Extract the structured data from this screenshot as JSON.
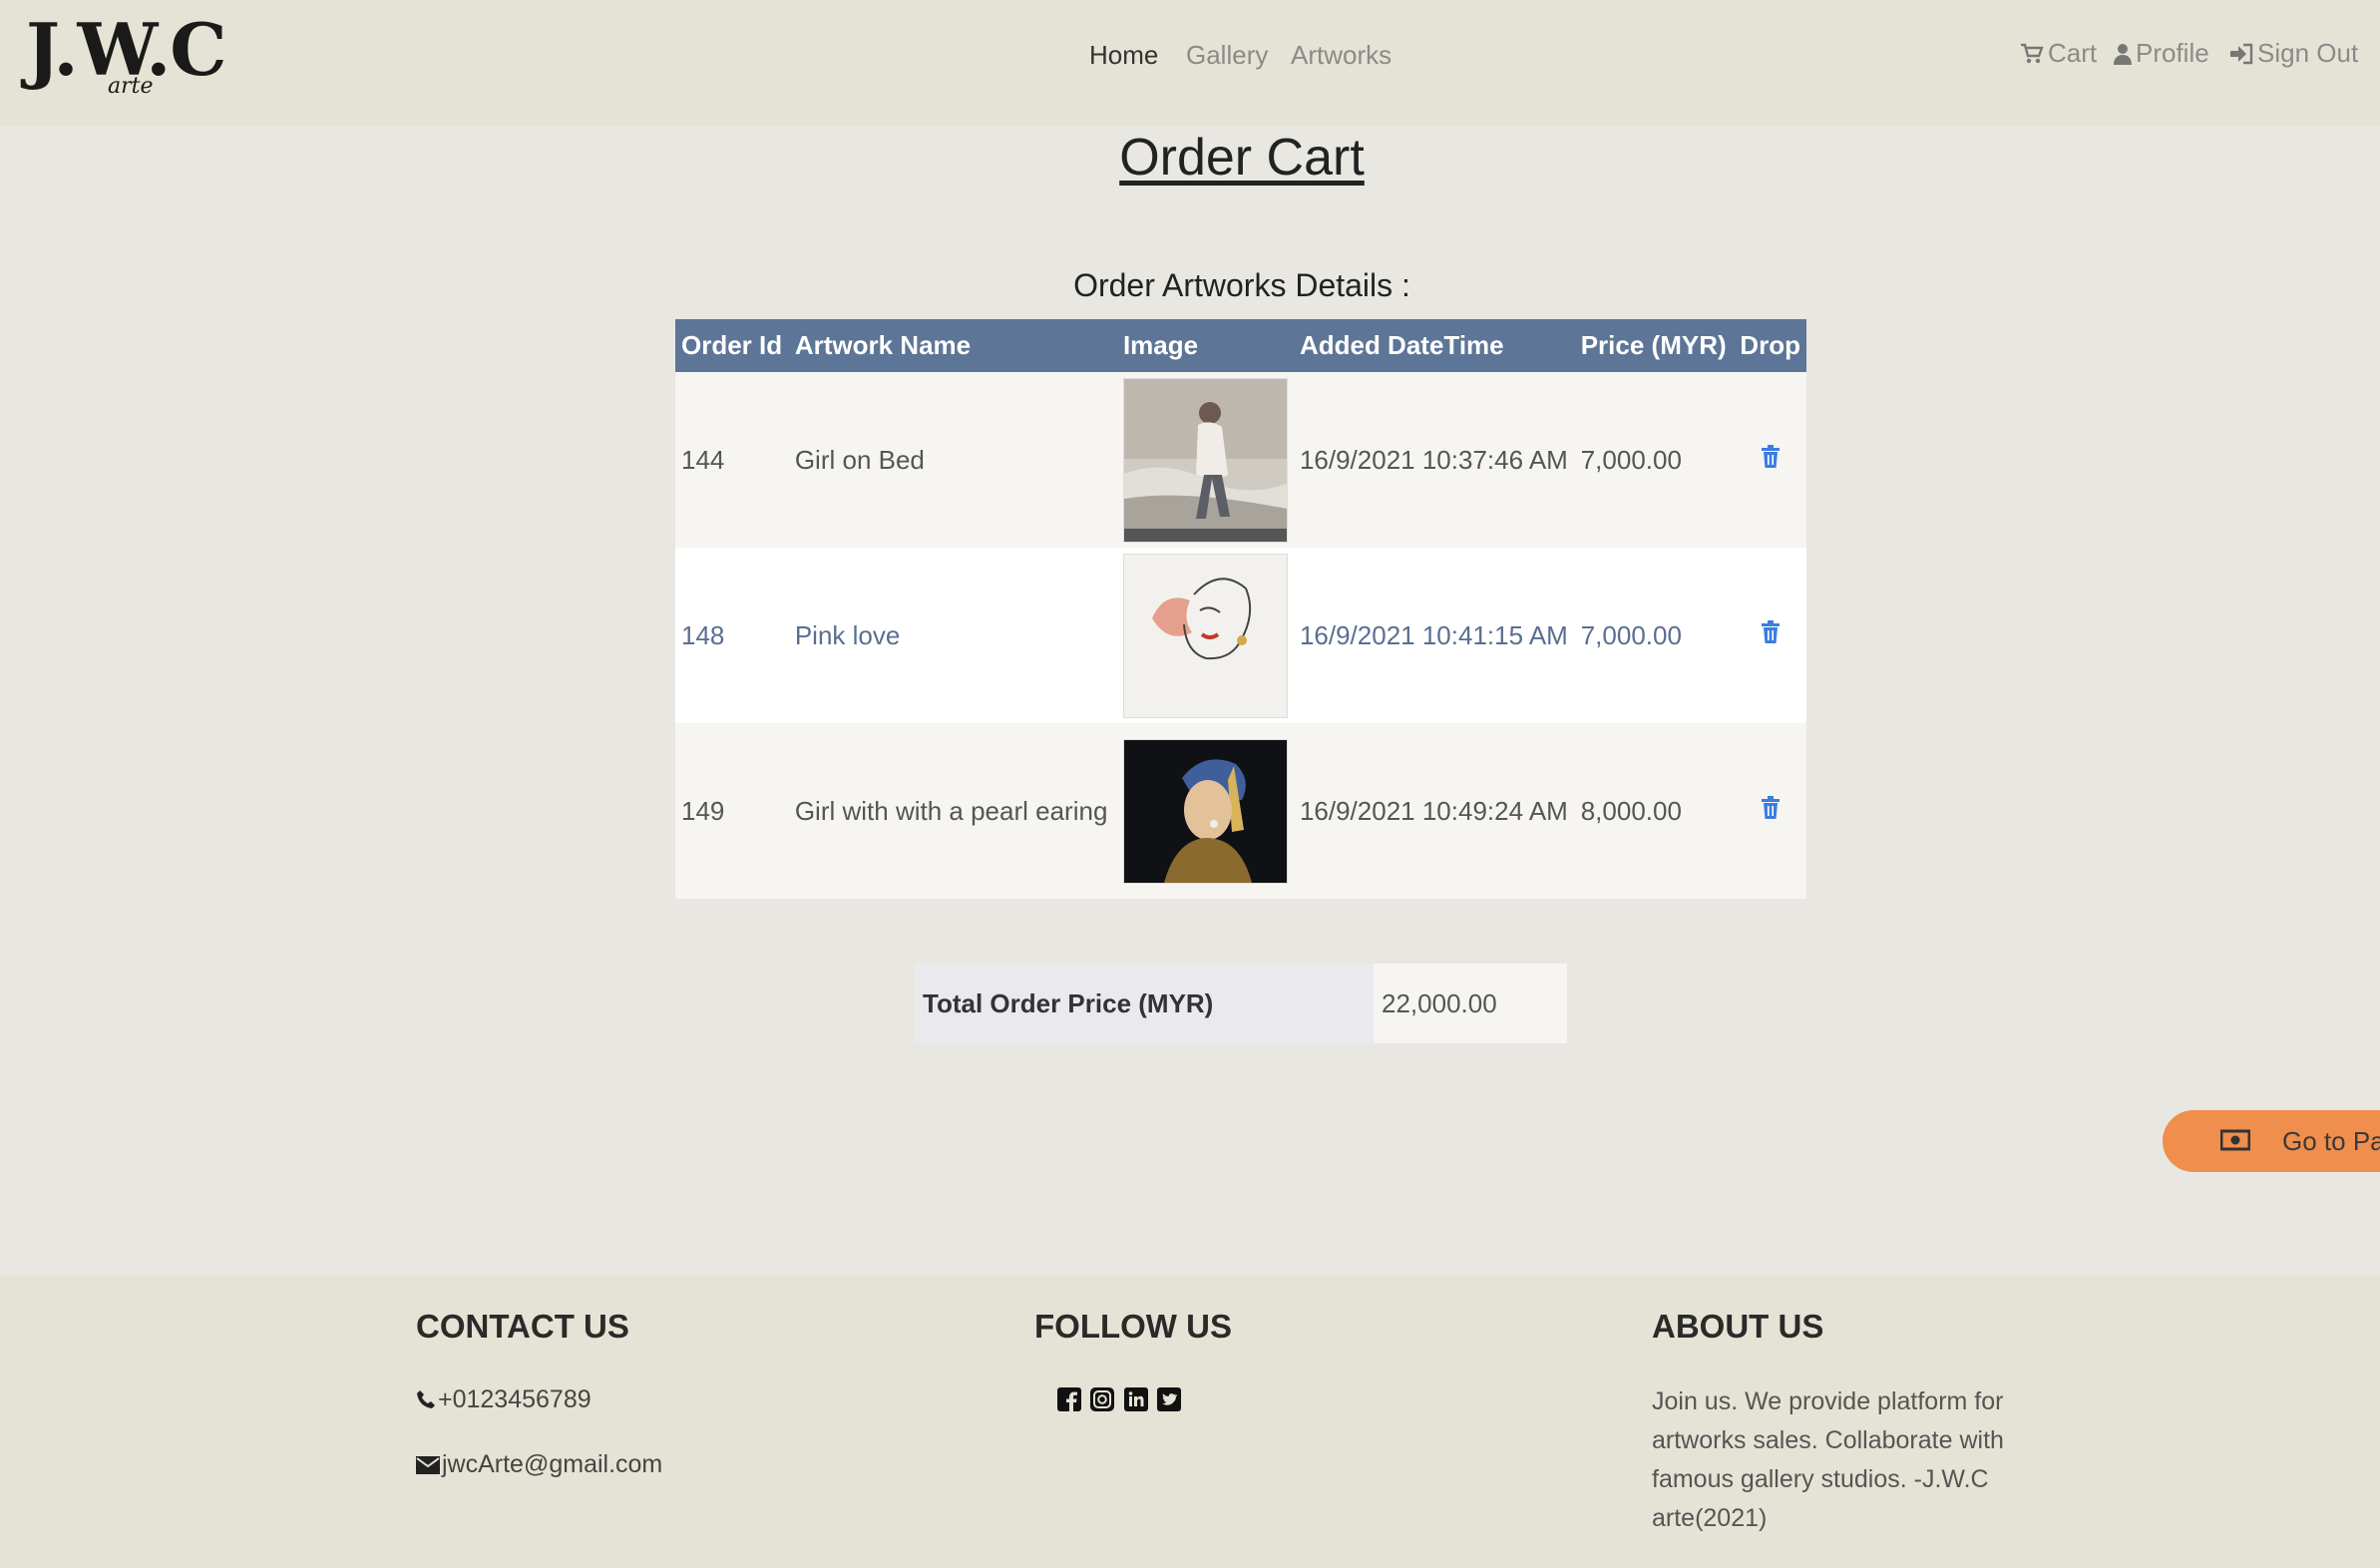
{
  "header": {
    "logo_main": "J.W.C",
    "logo_sub": "arte",
    "nav": [
      {
        "label": "Home",
        "active": true
      },
      {
        "label": "Gallery",
        "active": false
      },
      {
        "label": "Artworks",
        "active": false
      }
    ],
    "right_nav": [
      {
        "label": "Cart",
        "icon": "cart-icon"
      },
      {
        "label": "Profile",
        "icon": "user-icon"
      },
      {
        "label": "Sign Out",
        "icon": "sign-out-icon"
      }
    ]
  },
  "main": {
    "title": "Order Cart",
    "section_title": "Order Artworks Details :",
    "table": {
      "headers": [
        "Order Id",
        "Artwork Name",
        "Image",
        "Added DateTime",
        "Price (MYR)",
        "Drop"
      ],
      "rows": [
        {
          "order_id": "144",
          "artwork_name": "Girl on Bed",
          "image": "girl-on-bed-thumbnail",
          "added": "16/9/2021 10:37:46 AM",
          "price": "7,000.00"
        },
        {
          "order_id": "148",
          "artwork_name": "Pink love",
          "image": "pink-love-thumbnail",
          "added": "16/9/2021 10:41:15 AM",
          "price": "7,000.00"
        },
        {
          "order_id": "149",
          "artwork_name": "Girl with with a pearl earing",
          "image": "pearl-earing-thumbnail",
          "added": "16/9/2021 10:49:24 AM",
          "price": "8,000.00"
        }
      ]
    },
    "total": {
      "label": "Total Order Price (MYR)",
      "value": "22,000.00"
    },
    "pay_button": {
      "label": "Go to Pa",
      "icon": "money-icon"
    }
  },
  "footer": {
    "contact": {
      "heading": "CONTACT US",
      "phone": "+0123456789",
      "email": "jwcArte@gmail.com"
    },
    "follow": {
      "heading": "FOLLOW US",
      "icons": [
        "facebook-icon",
        "instagram-icon",
        "linkedin-icon",
        "twitter-icon"
      ]
    },
    "about": {
      "heading": "ABOUT US",
      "text": "Join us. We provide platform for artworks sales. Collaborate with famous gallery studios. -J.W.C arte(2021)"
    }
  },
  "colors": {
    "header_bg": "#e5e3d5",
    "page_bg": "#e8e7e2",
    "table_header_bg": "#5d7596",
    "pay_button_bg": "#ef8e4d",
    "trash_icon": "#3b7de0"
  }
}
